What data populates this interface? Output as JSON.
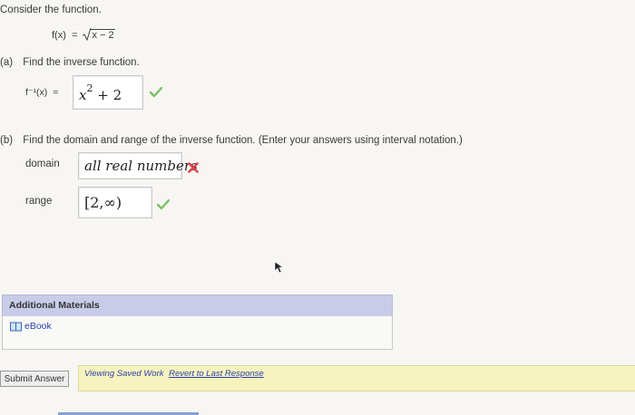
{
  "question": {
    "intro": "Consider the function.",
    "function_lhs": "f(x)",
    "equals": "=",
    "function_rhs": "x − 2"
  },
  "part_a": {
    "marker": "(a)",
    "prompt": "Find the inverse function.",
    "lhs": "f⁻¹(x)",
    "equals": "=",
    "answer_base": "x",
    "answer_exp": "2",
    "answer_rest": "+ 2",
    "status": "correct"
  },
  "part_b": {
    "marker": "(b)",
    "prompt": "Find the domain and range of the inverse function. (Enter your answers using interval notation.)",
    "domain_label": "domain",
    "domain_answer": "all real numbers",
    "domain_status": "incorrect",
    "range_label": "range",
    "range_answer": "[2,∞)",
    "range_status": "correct"
  },
  "additional_materials": {
    "header": "Additional Materials",
    "items": [
      {
        "label": "eBook",
        "icon": "book-icon"
      }
    ]
  },
  "footer": {
    "submit_label": "Submit Answer",
    "viewing_text": "Viewing Saved Work",
    "revert_link": "Revert to Last Response"
  },
  "colors": {
    "correct": "#7cc06a",
    "incorrect": "#d9434a",
    "panel_header": "#c9cce8",
    "status_bar": "#f6f3bf",
    "link": "#2b3fa8"
  }
}
